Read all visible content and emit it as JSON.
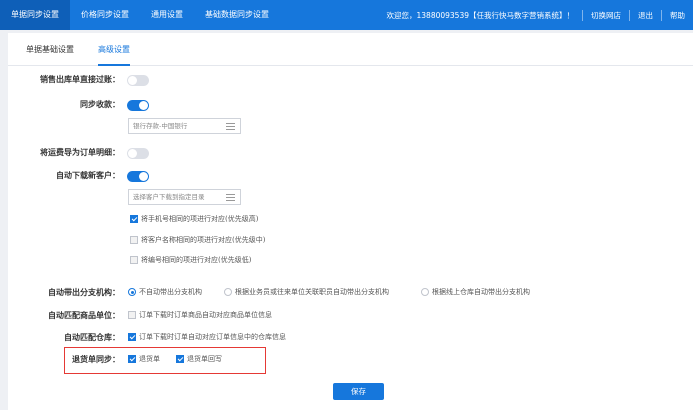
{
  "topnav": {
    "tabs": [
      {
        "label": "单据同步设置"
      },
      {
        "label": "价格同步设置"
      },
      {
        "label": "通用设置"
      },
      {
        "label": "基础数据同步设置"
      }
    ],
    "welcome": "欢迎您，13880093539【任我行快马数字营销系统】！",
    "switch_store": "切换网店",
    "logout": "退出",
    "help": "帮助"
  },
  "subtabs": [
    {
      "label": "单据基础设置"
    },
    {
      "label": "高级设置"
    }
  ],
  "settings": {
    "sales_out_direct": {
      "label": "销售出库单直接过账：",
      "on": false
    },
    "sync_receipt": {
      "label": "同步收款：",
      "on": true,
      "select_value": "银行存款-中国银行"
    },
    "return_fee_to_order": {
      "label": "将运费导为订单明细：",
      "on": false
    },
    "auto_download_customer": {
      "label": "自动下载新客户：",
      "on": true,
      "select_placeholder": "选择客户下载到指定目录",
      "options": [
        {
          "label": "将手机号相同的项进行对应(优先级高)",
          "checked": true
        },
        {
          "label": "将客户名称相同的项进行对应(优先级中)",
          "checked": false
        },
        {
          "label": "将编号相同的项进行对应(优先级低)",
          "checked": false
        }
      ]
    },
    "auto_branch": {
      "label": "自动带出分支机构：",
      "options": [
        {
          "label": "不自动带出分支机构",
          "checked": true
        },
        {
          "label": "根据业务员或往来单位关联职员自动带出分支机构",
          "checked": false
        },
        {
          "label": "根据线上仓库自动带出分支机构",
          "checked": false
        }
      ]
    },
    "match_unit": {
      "label": "自动匹配商品单位：",
      "option": "订单下载时订单商品自动对应商品单位信息",
      "checked": false
    },
    "match_warehouse": {
      "label": "自动匹配仓库：",
      "option": "订单下载时订单自动对应订单信息中的仓库信息",
      "checked": true
    },
    "return_sync": {
      "label": "退货单同步：",
      "options": [
        {
          "label": "退货单",
          "checked": true
        },
        {
          "label": "退货单回写",
          "checked": true
        }
      ]
    }
  },
  "save_label": "保存",
  "colors": {
    "primary": "#1677dc",
    "highlight_border": "#e53935"
  }
}
